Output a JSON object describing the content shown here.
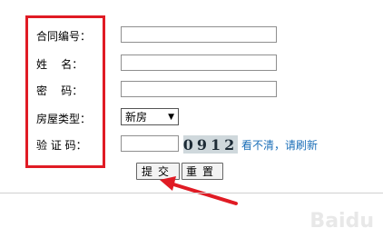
{
  "form": {
    "contract_no_label": "合同编号：",
    "name_label": "姓    名：",
    "password_label": "密    码：",
    "house_type_label": "房屋类型：",
    "captcha_label": "验 证 码：",
    "contract_no_value": "",
    "name_value": "",
    "password_value": "",
    "house_type_selected": "新房",
    "captcha_value": "",
    "captcha_image_text": "0912",
    "refresh_link": "看不清，请刷新",
    "submit_label": "提交",
    "reset_label": "重置"
  },
  "annotation": {
    "highlight_color": "#e01b24"
  },
  "watermark": "Baidu"
}
